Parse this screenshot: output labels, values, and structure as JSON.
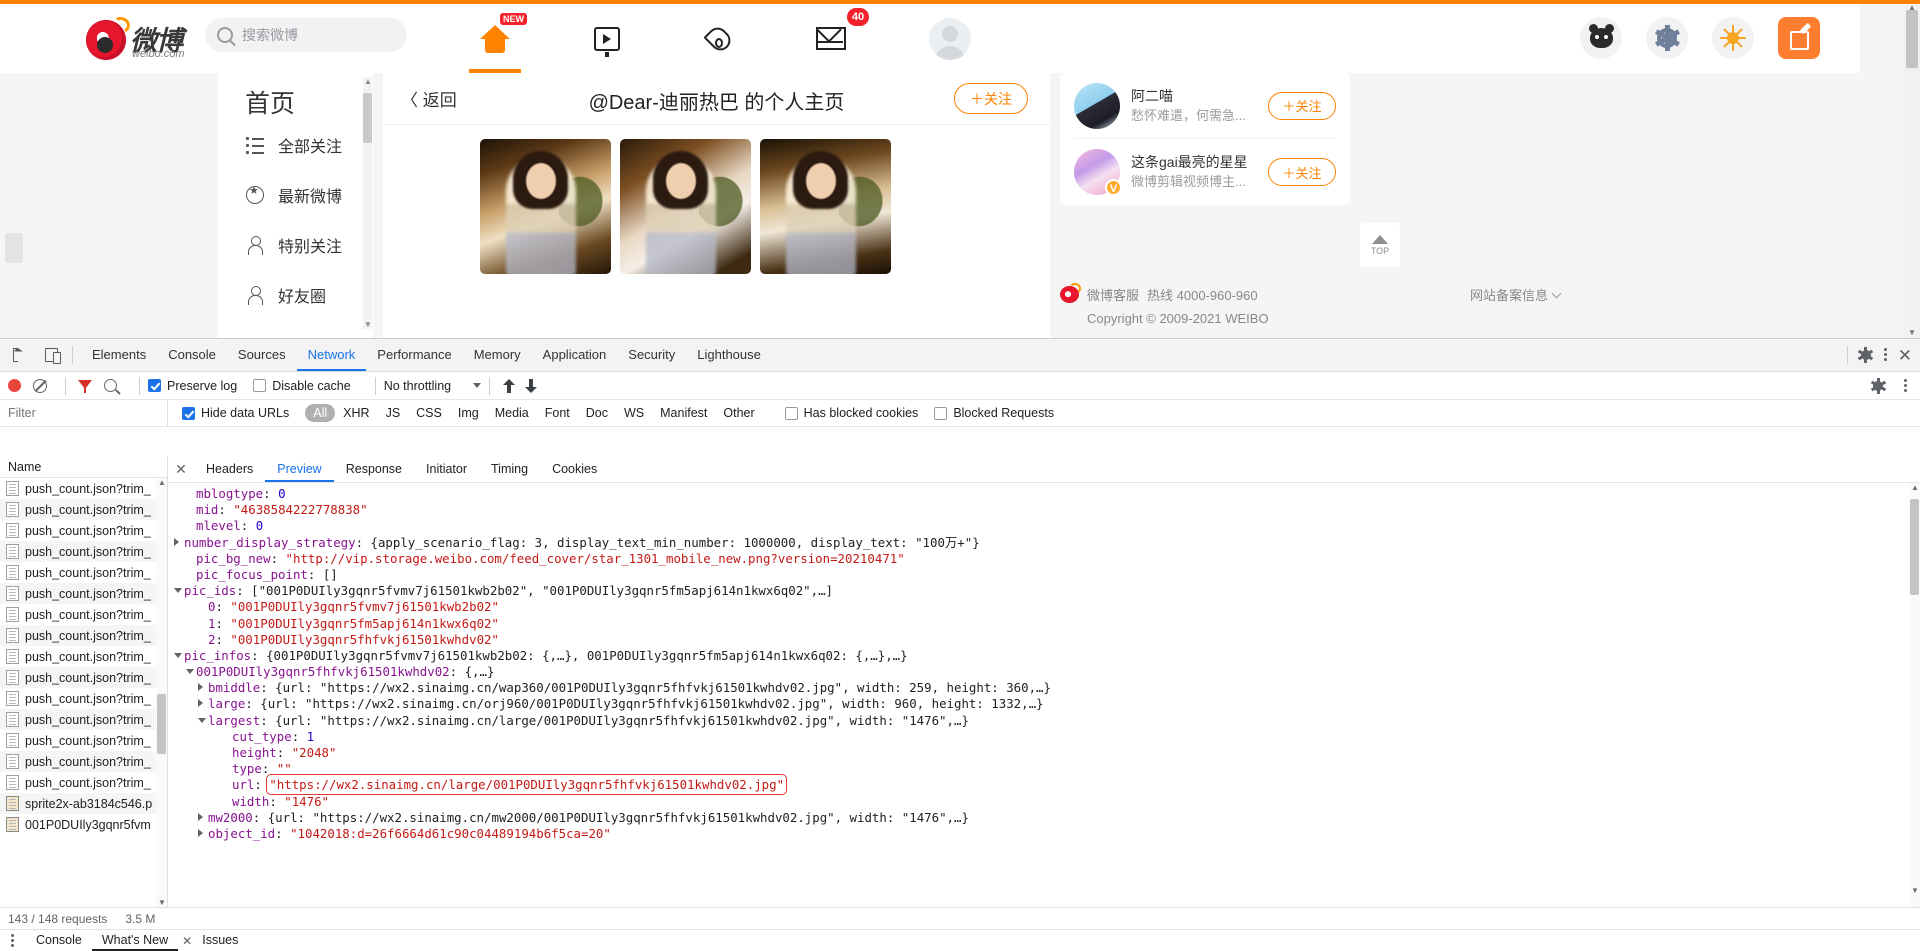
{
  "weibo": {
    "logo": {
      "text": "微博",
      "sub": "weibo.com"
    },
    "search": {
      "placeholder": "搜索微博"
    },
    "nav": [
      {
        "name": "home",
        "badge": "NEW",
        "active": true
      },
      {
        "name": "video",
        "badge": "",
        "active": false
      },
      {
        "name": "hot",
        "badge": "",
        "active": false
      },
      {
        "name": "message",
        "badge": "40",
        "active": false
      },
      {
        "name": "avatar",
        "badge": "",
        "active": false
      }
    ],
    "sidebar": {
      "title": "首页",
      "items": [
        {
          "label": "全部关注",
          "icon": "list-icon"
        },
        {
          "label": "最新微博",
          "icon": "star-icon"
        },
        {
          "label": "特别关注",
          "icon": "person-heart-icon"
        },
        {
          "label": "好友圈",
          "icon": "person-group-icon"
        }
      ]
    },
    "content": {
      "back_label": "返回",
      "profile_title": "@Dear-迪丽热巴 的个人主页",
      "follow_label": "＋关注"
    },
    "recommend": [
      {
        "name": "阿二喵",
        "desc": "愁怀难遣，何需急...",
        "follow": "＋关注",
        "verified": false
      },
      {
        "name": "这条gai最亮的星星",
        "desc": "微博剪辑视频博主...",
        "follow": "＋关注",
        "verified": true,
        "badge": "V"
      }
    ],
    "back_to_top": "TOP",
    "footer": {
      "service": "微博客服",
      "hotline": "热线 4000-960-960",
      "copyright": "Copyright © 2009-2021 WEIBO",
      "record": "网站备案信息"
    }
  },
  "devtools": {
    "panels": [
      "Elements",
      "Console",
      "Sources",
      "Network",
      "Performance",
      "Memory",
      "Application",
      "Security",
      "Lighthouse"
    ],
    "active_panel": "Network",
    "toolbar": {
      "preserve_log": {
        "label": "Preserve log",
        "checked": true
      },
      "disable_cache": {
        "label": "Disable cache",
        "checked": false
      },
      "throttling": "No throttling"
    },
    "filterbar": {
      "filter_placeholder": "Filter",
      "hide_data_urls": {
        "label": "Hide data URLs",
        "checked": true
      },
      "types": [
        "All",
        "XHR",
        "JS",
        "CSS",
        "Img",
        "Media",
        "Font",
        "Doc",
        "WS",
        "Manifest",
        "Other"
      ],
      "selected_type": "All",
      "has_blocked_cookies": {
        "label": "Has blocked cookies",
        "checked": false
      },
      "blocked_requests": {
        "label": "Blocked Requests",
        "checked": false
      }
    },
    "requests": {
      "header": "Name",
      "rows": [
        {
          "name": "push_count.json?trim_",
          "type": "json"
        },
        {
          "name": "push_count.json?trim_",
          "type": "json"
        },
        {
          "name": "push_count.json?trim_",
          "type": "json"
        },
        {
          "name": "push_count.json?trim_",
          "type": "json"
        },
        {
          "name": "push_count.json?trim_",
          "type": "json"
        },
        {
          "name": "push_count.json?trim_",
          "type": "json"
        },
        {
          "name": "push_count.json?trim_",
          "type": "json"
        },
        {
          "name": "push_count.json?trim_",
          "type": "json"
        },
        {
          "name": "push_count.json?trim_",
          "type": "json"
        },
        {
          "name": "push_count.json?trim_",
          "type": "json"
        },
        {
          "name": "push_count.json?trim_",
          "type": "json"
        },
        {
          "name": "push_count.json?trim_",
          "type": "json"
        },
        {
          "name": "push_count.json?trim_",
          "type": "json"
        },
        {
          "name": "push_count.json?trim_",
          "type": "json"
        },
        {
          "name": "push_count.json?trim_",
          "type": "json"
        },
        {
          "name": "sprite2x-ab3184c546.p",
          "type": "img"
        },
        {
          "name": "001P0DUIly3gqnr5fvm",
          "type": "img"
        }
      ]
    },
    "detail_tabs": [
      "Headers",
      "Preview",
      "Response",
      "Initiator",
      "Timing",
      "Cookies"
    ],
    "active_detail_tab": "Preview",
    "json_lines": [
      {
        "indent": 1,
        "tri": "",
        "key": "mblogtype",
        "sep": ": ",
        "val": "0",
        "vtype": "n"
      },
      {
        "indent": 1,
        "tri": "",
        "key": "mid",
        "sep": ": ",
        "val": "\"4638584222778838\"",
        "vtype": "s"
      },
      {
        "indent": 1,
        "tri": "",
        "key": "mlevel",
        "sep": ": ",
        "val": "0",
        "vtype": "n"
      },
      {
        "indent": 0,
        "tri": "closed",
        "key": "number_display_strategy",
        "sep": ": ",
        "val": "{apply_scenario_flag: 3, display_text_min_number: 1000000, display_text: \"100万+\"}",
        "vtype": "mixed"
      },
      {
        "indent": 1,
        "tri": "",
        "key": "pic_bg_new",
        "sep": ": ",
        "val": "\"http://vip.storage.weibo.com/feed_cover/star_1301_mobile_new.png?version=20210471\"",
        "vtype": "s"
      },
      {
        "indent": 1,
        "tri": "",
        "key": "pic_focus_point",
        "sep": ": ",
        "val": "[]",
        "vtype": "p"
      },
      {
        "indent": 0,
        "tri": "open",
        "key": "pic_ids",
        "sep": ": ",
        "val": "[\"001P0DUIly3gqnr5fvmv7j61501kwb2b02\", \"001P0DUIly3gqnr5fm5apj614n1kwx6q02\",…]",
        "vtype": "mixed"
      },
      {
        "indent": 2,
        "tri": "",
        "key": "0",
        "sep": ": ",
        "val": "\"001P0DUIly3gqnr5fvmv7j61501kwb2b02\"",
        "vtype": "s"
      },
      {
        "indent": 2,
        "tri": "",
        "key": "1",
        "sep": ": ",
        "val": "\"001P0DUIly3gqnr5fm5apj614n1kwx6q02\"",
        "vtype": "s"
      },
      {
        "indent": 2,
        "tri": "",
        "key": "2",
        "sep": ": ",
        "val": "\"001P0DUIly3gqnr5fhfvkj61501kwhdv02\"",
        "vtype": "s"
      },
      {
        "indent": 0,
        "tri": "open",
        "key": "pic_infos",
        "sep": ": ",
        "val": "{001P0DUIly3gqnr5fvmv7j61501kwb2b02: {,…}, 001P0DUIly3gqnr5fm5apj614n1kwx6q02: {,…},…}",
        "vtype": "mixed"
      },
      {
        "indent": 1,
        "tri": "open2",
        "key": "001P0DUIly3gqnr5fhfvkj61501kwhdv02",
        "sep": ": ",
        "val": "{,…}",
        "vtype": "mixed"
      },
      {
        "indent": 2,
        "tri": "closed2",
        "key": "bmiddle",
        "sep": ": ",
        "val": "{url: \"https://wx2.sinaimg.cn/wap360/001P0DUIly3gqnr5fhfvkj61501kwhdv02.jpg\", width: 259, height: 360,…}",
        "vtype": "mixed"
      },
      {
        "indent": 2,
        "tri": "closed2",
        "key": "large",
        "sep": ": ",
        "val": "{url: \"https://wx2.sinaimg.cn/orj960/001P0DUIly3gqnr5fhfvkj61501kwhdv02.jpg\", width: 960, height: 1332,…}",
        "vtype": "mixed"
      },
      {
        "indent": 2,
        "tri": "open3",
        "key": "largest",
        "sep": ": ",
        "val": "{url: \"https://wx2.sinaimg.cn/large/001P0DUIly3gqnr5fhfvkj61501kwhdv02.jpg\", width: \"1476\",…}",
        "vtype": "mixed"
      },
      {
        "indent": 4,
        "tri": "",
        "key": "cut_type",
        "sep": ": ",
        "val": "1",
        "vtype": "n"
      },
      {
        "indent": 4,
        "tri": "",
        "key": "height",
        "sep": ": ",
        "val": "\"2048\"",
        "vtype": "s"
      },
      {
        "indent": 4,
        "tri": "",
        "key": "type",
        "sep": ": ",
        "val": "\"\"",
        "vtype": "s"
      },
      {
        "indent": 4,
        "tri": "",
        "key": "url",
        "sep": ": ",
        "val": "\"https://wx2.sinaimg.cn/large/001P0DUIly3gqnr5fhfvkj61501kwhdv02.jpg\"",
        "vtype": "s",
        "highlight": true
      },
      {
        "indent": 4,
        "tri": "",
        "key": "width",
        "sep": ": ",
        "val": "\"1476\"",
        "vtype": "s"
      },
      {
        "indent": 2,
        "tri": "closed2",
        "key": "mw2000",
        "sep": ": ",
        "val": "{url: \"https://wx2.sinaimg.cn/mw2000/001P0DUIly3gqnr5fhfvkj61501kwhdv02.jpg\", width: \"1476\",…}",
        "vtype": "mixed"
      },
      {
        "indent": 2,
        "tri": "closed2",
        "key": "object_id",
        "sep": ": ",
        "val": "\"1042018:d=26f6664d61c90c04489194b6f5ca=20\"",
        "vtype": "s"
      }
    ],
    "status": {
      "requests": "143 / 148 requests",
      "transferred": "3.5 M"
    },
    "drawer": {
      "tabs": [
        "Console",
        "What's New",
        "Issues"
      ],
      "active": "What's New"
    }
  }
}
